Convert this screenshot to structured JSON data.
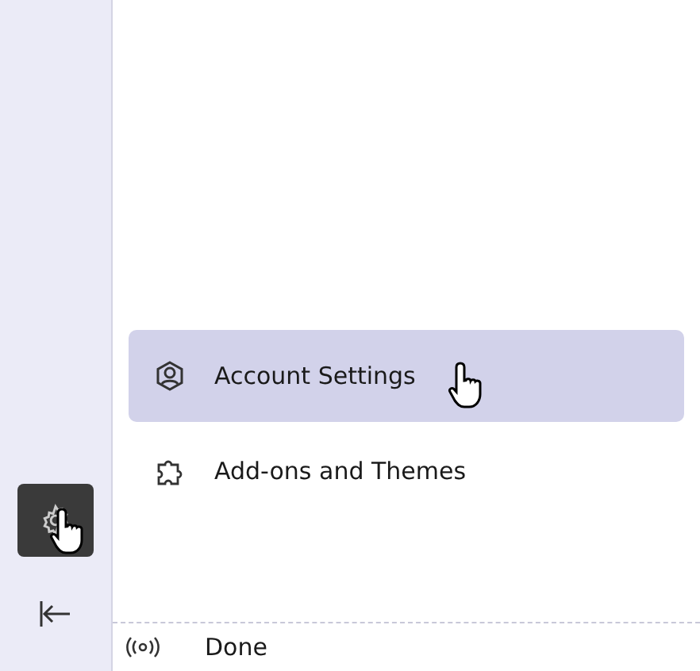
{
  "sidebar": {
    "settings_button": {
      "selected": true
    }
  },
  "menu": [
    {
      "label": "Account Settings",
      "kind": "account",
      "selected": true
    },
    {
      "label": "Add-ons and Themes",
      "kind": "addons",
      "selected": false
    }
  ],
  "status_bar": {
    "text": "Done"
  }
}
